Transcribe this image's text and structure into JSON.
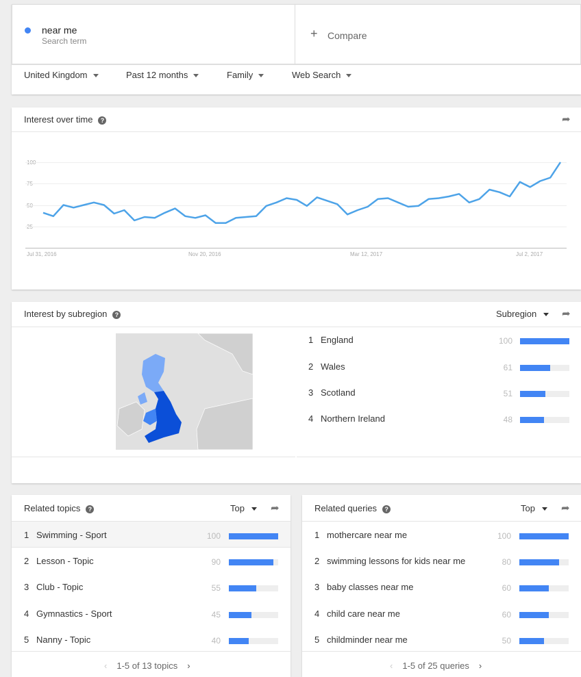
{
  "search": {
    "term": "near me",
    "term_subtitle": "Search term",
    "term_color": "#4285f4",
    "compare_label": "Compare"
  },
  "filters": [
    {
      "label": "United Kingdom"
    },
    {
      "label": "Past 12 months"
    },
    {
      "label": "Family"
    },
    {
      "label": "Web Search"
    }
  ],
  "interest_over_time": {
    "title": "Interest over time",
    "chart_data": {
      "type": "line",
      "y_ticks": [
        "100",
        "75",
        "50",
        "25"
      ],
      "x_ticks": [
        "Jul 31, 2016",
        "Nov 20, 2016",
        "Mar 12, 2017",
        "Jul 2, 2017"
      ],
      "ylim": [
        0,
        100
      ],
      "color": "#4285f4",
      "values": [
        41,
        37,
        50,
        47,
        50,
        53,
        50,
        40,
        44,
        32,
        36,
        35,
        41,
        46,
        37,
        35,
        38,
        29,
        29,
        35,
        36,
        37,
        49,
        53,
        58,
        56,
        49,
        59,
        55,
        51,
        39,
        44,
        48,
        57,
        58,
        53,
        48,
        49,
        57,
        58,
        60,
        63,
        53,
        57,
        68,
        65,
        60,
        77,
        71,
        78,
        82,
        100
      ]
    }
  },
  "subregion": {
    "title": "Interest by subregion",
    "dropdown_label": "Subregion",
    "rows": [
      {
        "rank": "1",
        "name": "England",
        "value": "100",
        "pct": 100
      },
      {
        "rank": "2",
        "name": "Wales",
        "value": "61",
        "pct": 61
      },
      {
        "rank": "3",
        "name": "Scotland",
        "value": "51",
        "pct": 51
      },
      {
        "rank": "4",
        "name": "Northern Ireland",
        "value": "48",
        "pct": 48
      }
    ]
  },
  "related_topics": {
    "title": "Related topics",
    "dropdown_label": "Top",
    "rows": [
      {
        "rank": "1",
        "name": "Swimming - Sport",
        "value": "100",
        "pct": 100
      },
      {
        "rank": "2",
        "name": "Lesson - Topic",
        "value": "90",
        "pct": 90
      },
      {
        "rank": "3",
        "name": "Club - Topic",
        "value": "55",
        "pct": 55
      },
      {
        "rank": "4",
        "name": "Gymnastics - Sport",
        "value": "45",
        "pct": 45
      },
      {
        "rank": "5",
        "name": "Nanny - Topic",
        "value": "40",
        "pct": 40
      }
    ],
    "pager": "1-5 of 13 topics"
  },
  "related_queries": {
    "title": "Related queries",
    "dropdown_label": "Top",
    "rows": [
      {
        "rank": "1",
        "name": "mothercare near me",
        "value": "100",
        "pct": 100
      },
      {
        "rank": "2",
        "name": "swimming lessons for kids near me",
        "value": "80",
        "pct": 80
      },
      {
        "rank": "3",
        "name": "baby classes near me",
        "value": "60",
        "pct": 60
      },
      {
        "rank": "4",
        "name": "child care near me",
        "value": "60",
        "pct": 60
      },
      {
        "rank": "5",
        "name": "childminder near me",
        "value": "50",
        "pct": 50
      }
    ],
    "pager": "1-5 of 25 queries"
  },
  "icons": {
    "help": "help-circle-icon",
    "share": "share-arrow-icon",
    "dropdown": "caret-down-icon",
    "prev": "chevron-left-icon",
    "next": "chevron-right-icon"
  }
}
